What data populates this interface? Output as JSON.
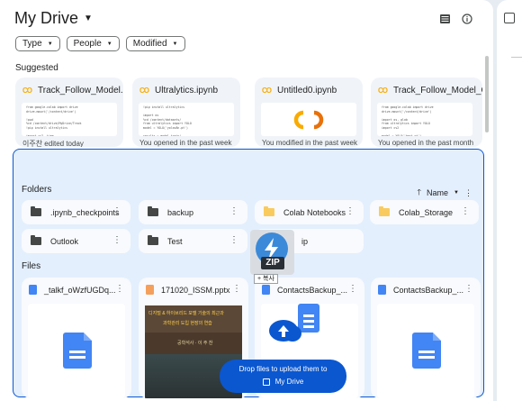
{
  "header": {
    "title": "My Drive"
  },
  "filters": [
    "Type",
    "People",
    "Modified"
  ],
  "suggested": {
    "label": "Suggested",
    "cards": [
      {
        "name": "Track_Follow_Model.ip...",
        "footer": "이주찬 edited today",
        "code": "from google.colab import drive\ndrive.mount('/content/drive')\n\n!pwd\n%cd /content/drive/MyDrive/Track\n!pip install ultralytics\n\nimport cv2, time\nfrom ultralytics import YOLO\nimport numpy as np\nmodel = YOLO('best.pt')"
      },
      {
        "name": "Ultralytics.ipynb",
        "footer": "You opened in the past week",
        "code": "!pip install ultralytics\n\nimport os\n%cd /content/datasets/\nfrom ultralytics import YOLO\nmodel = YOLO('yolov8n.pt')\n\nresults = model.train(\n  data='data.yaml', epochs=50)\n\nmetrics = model.val()"
      },
      {
        "name": "Untitled0.ipynb",
        "footer": "You modified in the past week"
      },
      {
        "name": "Track_Follow_Model_O...",
        "footer": "You opened in the past month",
        "code": "from google.colab import drive\ndrive.mount('/content/drive')\n\nimport os, glob\nfrom ultralytics import YOLO\nimport cv2\n\nmodel = YOLO('best.pt')\nmodel.export(format='onnx')"
      }
    ]
  },
  "folders": {
    "label": "Folders",
    "sort_label": "Name",
    "items": [
      {
        "name": ".ipynb_checkpoints",
        "color": "#444746"
      },
      {
        "name": "backup",
        "color": "#444746"
      },
      {
        "name": "Colab Notebooks",
        "color": "#f9cb5f"
      },
      {
        "name": "Colab_Storage",
        "color": "#f9cb5f"
      },
      {
        "name": "Outlook",
        "color": "#444746"
      },
      {
        "name": "Test",
        "color": "#444746"
      },
      {
        "name": "ip",
        "color": "#444746"
      }
    ]
  },
  "files": {
    "label": "Files",
    "items": [
      {
        "name": "_talkf_oWzfUGDq...",
        "kind": "doc"
      },
      {
        "name": "171020_ISSM.pptx",
        "kind": "slides"
      },
      {
        "name": "ContactsBackup_...",
        "kind": "doc"
      },
      {
        "name": "ContactsBackup_...",
        "kind": "doc"
      }
    ],
    "slide_text": {
      "line1": "디지털 & 하이브리드 모델 기술의 최근과",
      "line2": "과학관리 도입 현장의 연습",
      "line3": "공학석사 · 이 주 찬"
    }
  },
  "drag": {
    "badge_text": "ZIP",
    "copy_label": "+ 복사"
  },
  "upload": {
    "line1": "Drop files to upload them to",
    "line2": "My Drive"
  },
  "colors": {
    "accent": "#0b57d0",
    "dropzone": "#e3effd",
    "folder_yellow": "#f9cb5f"
  }
}
